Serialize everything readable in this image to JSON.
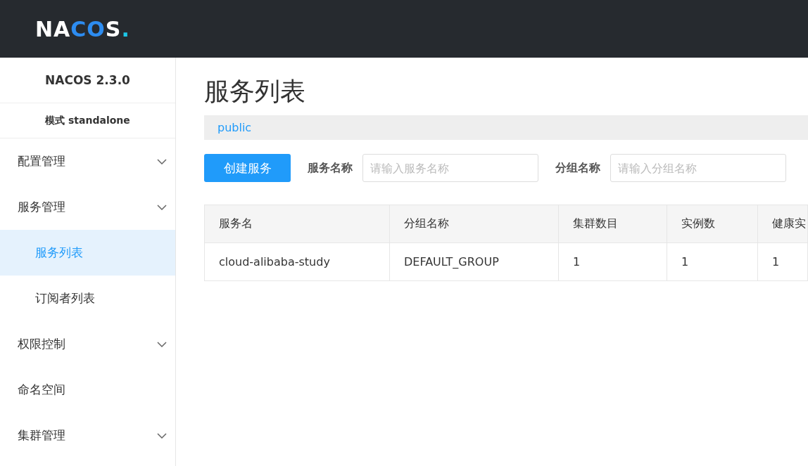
{
  "header": {
    "logo": [
      "NA",
      "CO",
      "S",
      "."
    ]
  },
  "sidebar": {
    "title": "NACOS 2.3.0",
    "mode": "模式 standalone",
    "items": [
      {
        "kind": "group",
        "label": "配置管理"
      },
      {
        "kind": "group",
        "label": "服务管理",
        "children": [
          {
            "label": "服务列表",
            "selected": true
          },
          {
            "label": "订阅者列表",
            "selected": false
          }
        ]
      },
      {
        "kind": "group",
        "label": "权限控制"
      },
      {
        "kind": "link",
        "label": "命名空间"
      },
      {
        "kind": "group",
        "label": "集群管理"
      }
    ]
  },
  "page": {
    "title": "服务列表",
    "namespace": "public",
    "toolbar": {
      "create_button": "创建服务",
      "filters": [
        {
          "label": "服务名称",
          "placeholder": "请输入服务名称"
        },
        {
          "label": "分组名称",
          "placeholder": "请输入分组名称"
        }
      ]
    },
    "table": {
      "columns": [
        "服务名",
        "分组名称",
        "集群数目",
        "实例数",
        "健康实"
      ],
      "rows": [
        [
          "cloud-alibaba-study",
          "DEFAULT_GROUP",
          "1",
          "1",
          "1"
        ]
      ]
    }
  }
}
